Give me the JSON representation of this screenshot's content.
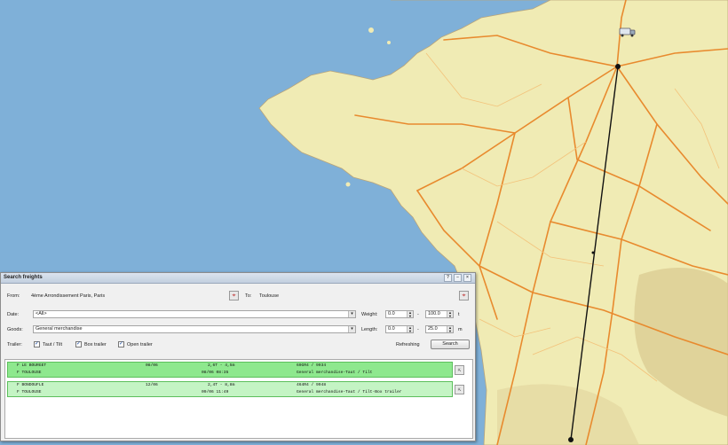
{
  "map": {
    "colors": {
      "sea": "#7fb0d8",
      "land": "#f0ebb4",
      "road": "#e88a2e",
      "route": "#111111"
    },
    "icons": [
      "truck-icon",
      "origin-marker-icon",
      "destination-marker-icon"
    ]
  },
  "dialog": {
    "title": "Search freights",
    "from_label": "From:",
    "from_value": "4ème Arrondissement Paris, Paris",
    "to_label": "To:",
    "to_value": "Toulouse",
    "date_label": "Date:",
    "date_value": "<All>",
    "goods_label": "Goods:",
    "goods_value": "General merchandise",
    "weight_label": "Weight:",
    "weight_min": "0.0",
    "weight_max": "100.0",
    "weight_unit": "t",
    "length_label": "Length:",
    "length_min": "0.0",
    "length_max": "25.0",
    "length_unit": "m",
    "range_sep": "-",
    "trailer_label": "Trailer:",
    "trailers": [
      {
        "label": "Taut / Tilt",
        "checked": true
      },
      {
        "label": "Box trailer",
        "checked": true
      },
      {
        "label": "Open trailer",
        "checked": true
      }
    ],
    "refreshing_label": "Refreshing",
    "search_button": "Search"
  },
  "results": [
    {
      "from": "F LE BOURGET",
      "date_from": "08/06",
      "load": "2,6T -  4,5m",
      "ref": "69GR4 /   9934",
      "to": "F TOULOUSE",
      "date_to": "08/06 08:35",
      "goods": "General merchandise-Taut / Tilt",
      "color": "#8ee88e"
    },
    {
      "from": "F BONDOUFLE",
      "date_from": "12/06",
      "load": "2,4T -  8,8m",
      "ref": "464R4 /   9948",
      "to": "F TOULOUSE",
      "date_to": "09/06 11:49",
      "goods": "General merchandise-Taut / Tilt-Box trailer",
      "color": "#c4f4c4"
    }
  ]
}
